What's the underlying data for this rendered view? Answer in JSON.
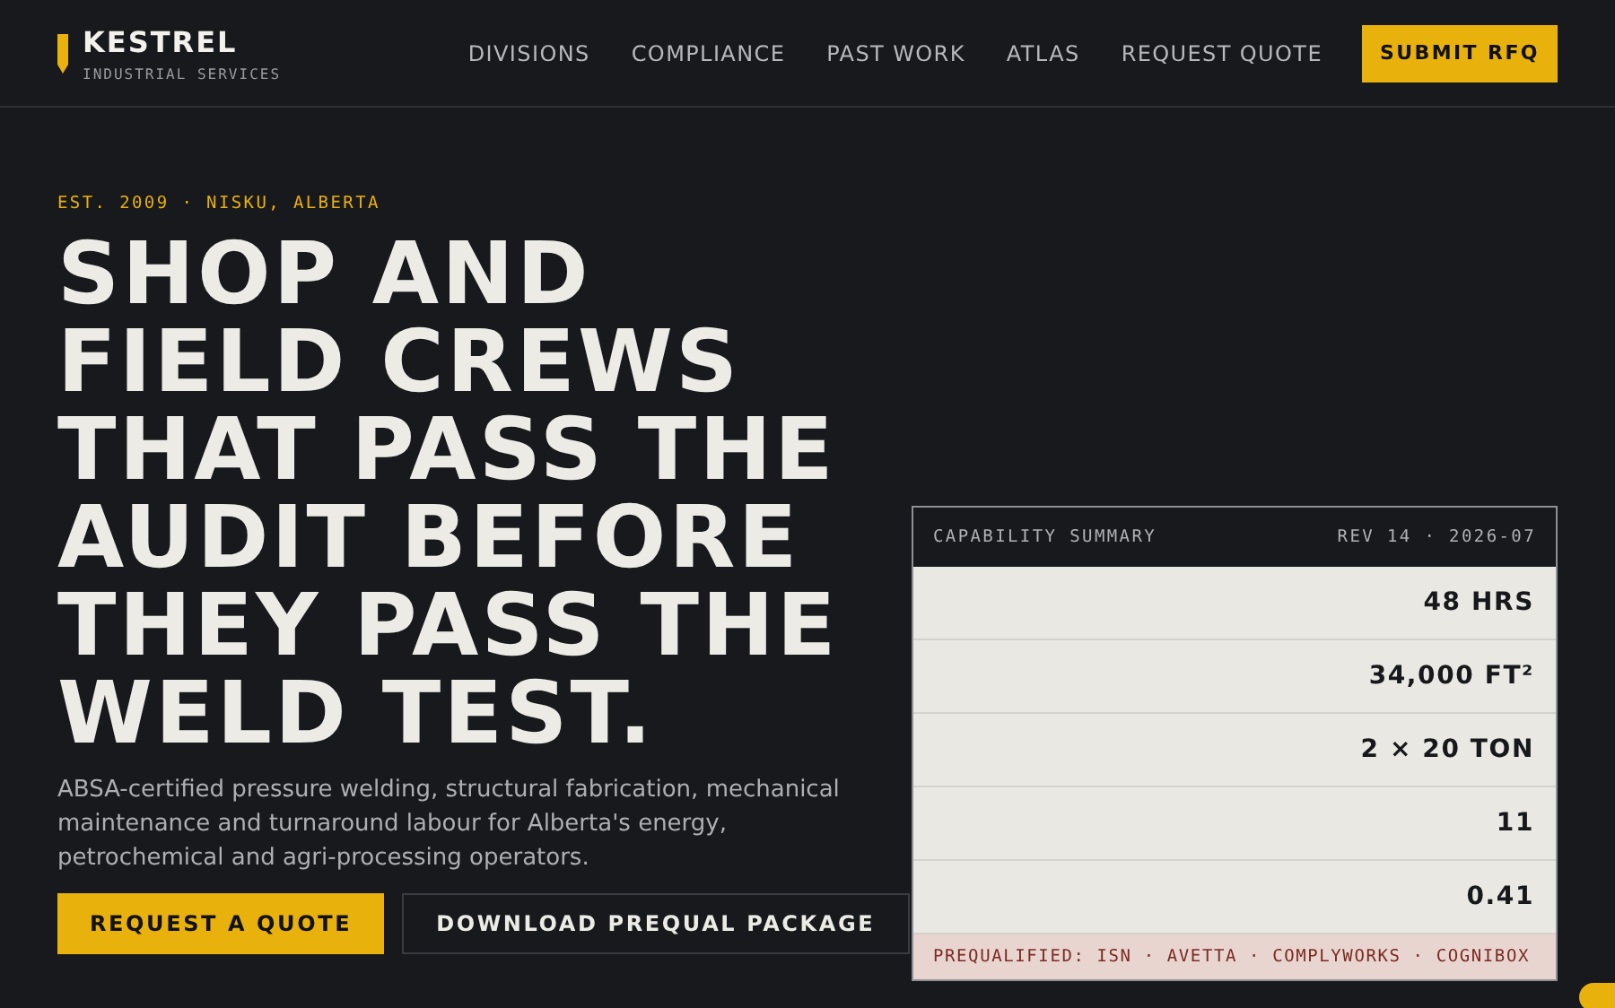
{
  "brand": {
    "name": "KESTREL",
    "tagline": "INDUSTRIAL SERVICES"
  },
  "nav": [
    {
      "label": "DIVISIONS"
    },
    {
      "label": "COMPLIANCE"
    },
    {
      "label": "PAST WORK"
    },
    {
      "label": "ATLAS"
    },
    {
      "label": "REQUEST QUOTE"
    }
  ],
  "header_button": "SUBMIT RFQ",
  "hero": {
    "eyebrow": "EST. 2009 · NISKU, ALBERTA",
    "headline": "SHOP AND FIELD CREWS THAT PASS THE AUDIT BEFORE THEY PASS THE WELD TEST.",
    "lede": "ABSA-certified pressure welding, structural fabrication, mechanical maintenance and turnaround labour for Alberta's energy, petrochemical and agri-processing operators.",
    "buttons": [
      {
        "label": "REQUEST A QUOTE",
        "kind": "primary"
      },
      {
        "label": "DOWNLOAD PREQUAL PACKAGE",
        "kind": "outline"
      }
    ]
  },
  "summary": {
    "title": "CAPABILITY SUMMARY",
    "revision": "REV 14 · 2026-07",
    "rows": [
      {
        "value": "48 HRS"
      },
      {
        "value": "34,000 FT²"
      },
      {
        "value": "2 × 20 TON"
      },
      {
        "value": "11"
      },
      {
        "value": "0.41"
      }
    ],
    "footer": "PREQUALIFIED: ISN · AVETTA · COMPLYWORKS · COGNIBOX"
  }
}
